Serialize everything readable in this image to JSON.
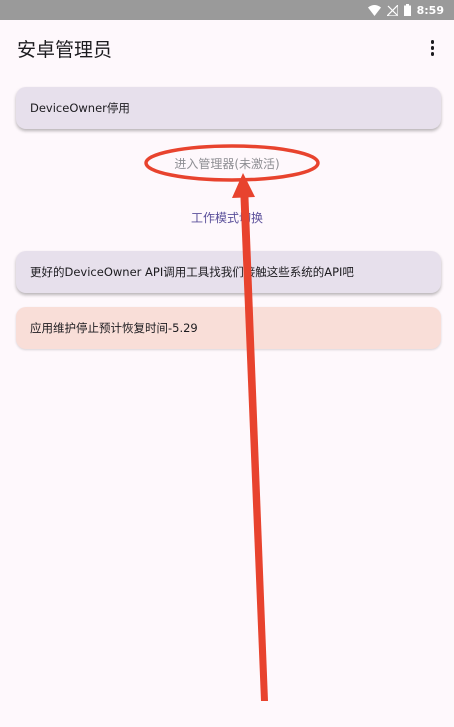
{
  "status_bar": {
    "time": "8:59",
    "icons": [
      "wifi-icon",
      "signal-icon",
      "battery-icon"
    ]
  },
  "app_bar": {
    "title": "安卓管理员",
    "menu_icon": "more-vert-icon"
  },
  "cards": {
    "device_owner": "DeviceOwner停用",
    "api_tool": "更好的DeviceOwner API调用工具找我们接触这些系统的API吧",
    "maintenance": "应用维护停止预计恢复时间-5.29"
  },
  "links": {
    "enter_admin": "进入管理器(未激活)",
    "switch_mode": "工作模式切换"
  },
  "colors": {
    "background": "#fef8fc",
    "card": "#e7e0ec",
    "notice_card": "#f9ded8",
    "link_primary": "#5a4f9a",
    "annotation_red": "#e8432e"
  }
}
